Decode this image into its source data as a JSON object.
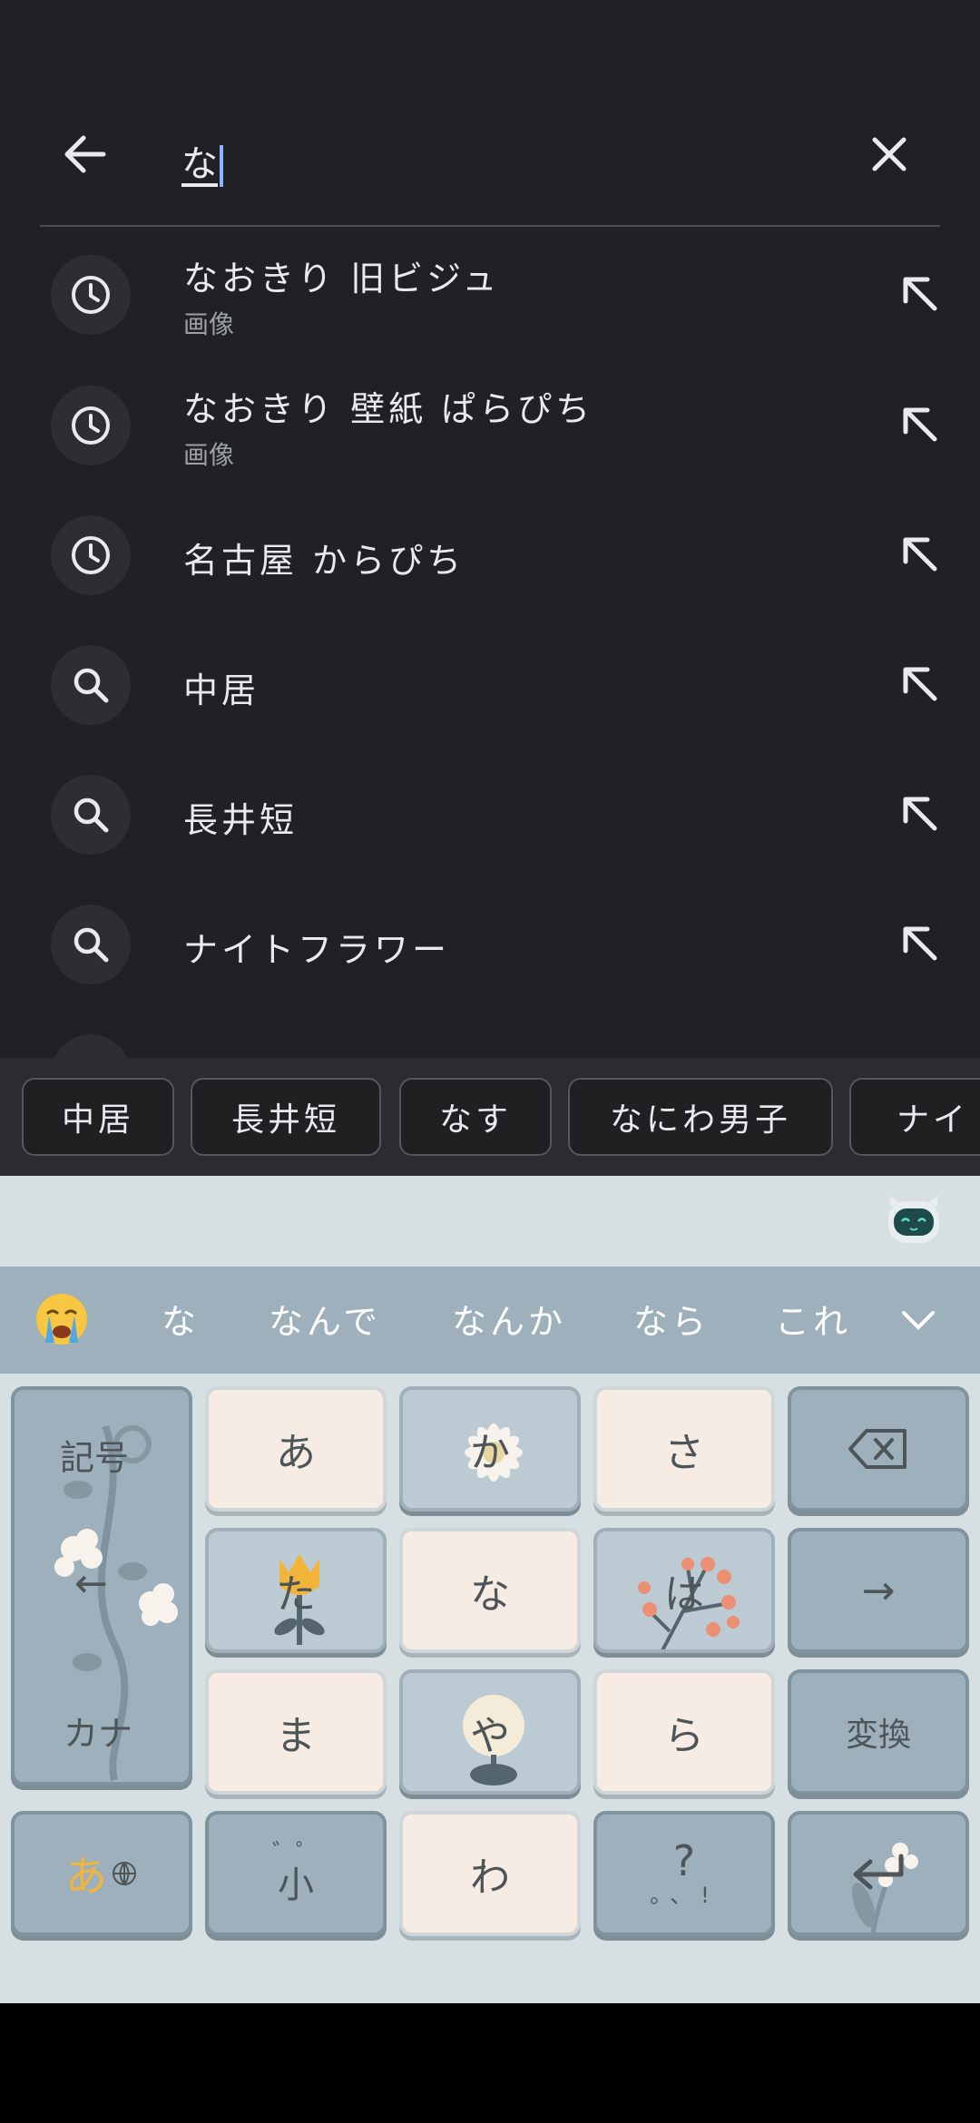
{
  "search": {
    "query": "な",
    "suggestions": [
      {
        "text": "なおきり 旧ビジュ",
        "subtext": "画像",
        "icon": "history-icon"
      },
      {
        "text": "なおきり 壁紙 ぱらぴち",
        "subtext": "画像",
        "icon": "history-icon"
      },
      {
        "text": "名古屋 からぴち",
        "subtext": "",
        "icon": "history-icon"
      },
      {
        "text": "中居",
        "subtext": "",
        "icon": "search-icon"
      },
      {
        "text": "長井短",
        "subtext": "",
        "icon": "search-icon"
      },
      {
        "text": "ナイトフラワー",
        "subtext": "",
        "icon": "search-icon"
      }
    ]
  },
  "chips": [
    "中居",
    "長井短",
    "なす",
    "なにわ男子",
    "ナイト"
  ],
  "keyboard": {
    "candidates": [
      "な",
      "なんで",
      "なんか",
      "なら",
      "これ"
    ],
    "keys": {
      "symbols": "記号",
      "kana": "カナ",
      "left_arrow": "←",
      "right_arrow": "→",
      "a": "あ",
      "ka": "か",
      "sa": "さ",
      "ta": "た",
      "na": "な",
      "ha": "は",
      "ma": "ま",
      "ya": "や",
      "ra": "ら",
      "wa": "わ",
      "convert": "変換",
      "mode": "あ",
      "dakuten": "゛゜",
      "small": "小",
      "punct_q": "?",
      "punct": "。、!"
    },
    "colors": {
      "accent": "#f2b53a",
      "key_light": "#f6ece3",
      "key_blue": "#bccbd3",
      "key_dark": "#9eb0bb"
    }
  }
}
